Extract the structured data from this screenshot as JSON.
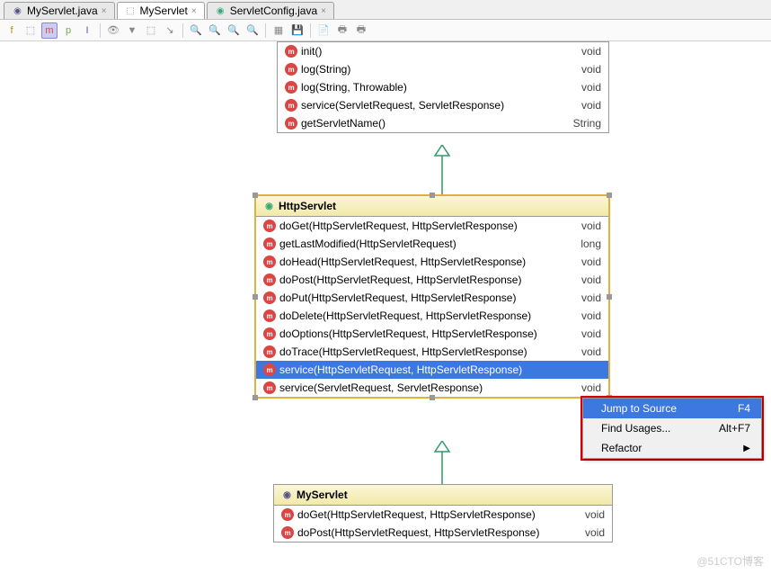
{
  "tabs": [
    {
      "label": "MyServlet.java",
      "icon": "class",
      "active": false
    },
    {
      "label": "MyServlet",
      "icon": "diagram",
      "active": true
    },
    {
      "label": "ServletConfig.java",
      "icon": "interface",
      "active": false
    }
  ],
  "toolbar": {
    "buttons": [
      "f",
      "a",
      "m",
      "p",
      "c",
      "f2",
      "t",
      "f3",
      "arr",
      "z1",
      "z2",
      "z3",
      "z4",
      "l1",
      "l2",
      "s1",
      "s2",
      "s3"
    ]
  },
  "box_top": {
    "selected": false,
    "members": [
      {
        "name": "init()",
        "type": "void",
        "sel": false
      },
      {
        "name": "log(String)",
        "type": "void",
        "sel": false
      },
      {
        "name": "log(String, Throwable)",
        "type": "void",
        "sel": false
      },
      {
        "name": "service(ServletRequest, ServletResponse)",
        "type": "void",
        "sel": false
      },
      {
        "name": "getServletName()",
        "type": "String",
        "sel": false
      }
    ]
  },
  "box_mid": {
    "title": "HttpServlet",
    "selected": true,
    "members": [
      {
        "name": "doGet(HttpServletRequest, HttpServletResponse)",
        "type": "void",
        "sel": false
      },
      {
        "name": "getLastModified(HttpServletRequest)",
        "type": "long",
        "sel": false
      },
      {
        "name": "doHead(HttpServletRequest, HttpServletResponse)",
        "type": "void",
        "sel": false
      },
      {
        "name": "doPost(HttpServletRequest, HttpServletResponse)",
        "type": "void",
        "sel": false
      },
      {
        "name": "doPut(HttpServletRequest, HttpServletResponse)",
        "type": "void",
        "sel": false
      },
      {
        "name": "doDelete(HttpServletRequest, HttpServletResponse)",
        "type": "void",
        "sel": false
      },
      {
        "name": "doOptions(HttpServletRequest, HttpServletResponse)",
        "type": "void",
        "sel": false
      },
      {
        "name": "doTrace(HttpServletRequest, HttpServletResponse)",
        "type": "void",
        "sel": false
      },
      {
        "name": "service(HttpServletRequest, HttpServletResponse)",
        "type": "",
        "sel": true
      },
      {
        "name": "service(ServletRequest, ServletResponse)",
        "type": "void",
        "sel": false
      }
    ]
  },
  "box_bot": {
    "title": "MyServlet",
    "selected": false,
    "members": [
      {
        "name": "doGet(HttpServletRequest, HttpServletResponse)",
        "type": "void",
        "sel": false
      },
      {
        "name": "doPost(HttpServletRequest, HttpServletResponse)",
        "type": "void",
        "sel": false
      }
    ]
  },
  "ctx": {
    "items": [
      {
        "label": "Jump to Source",
        "accel": "F4",
        "sel": true,
        "sub": false
      },
      {
        "label": "Find Usages...",
        "accel": "Alt+F7",
        "sel": false,
        "sub": false
      },
      {
        "label": "Refactor",
        "accel": "",
        "sel": false,
        "sub": true
      }
    ]
  },
  "watermark": "@51CTO博客"
}
